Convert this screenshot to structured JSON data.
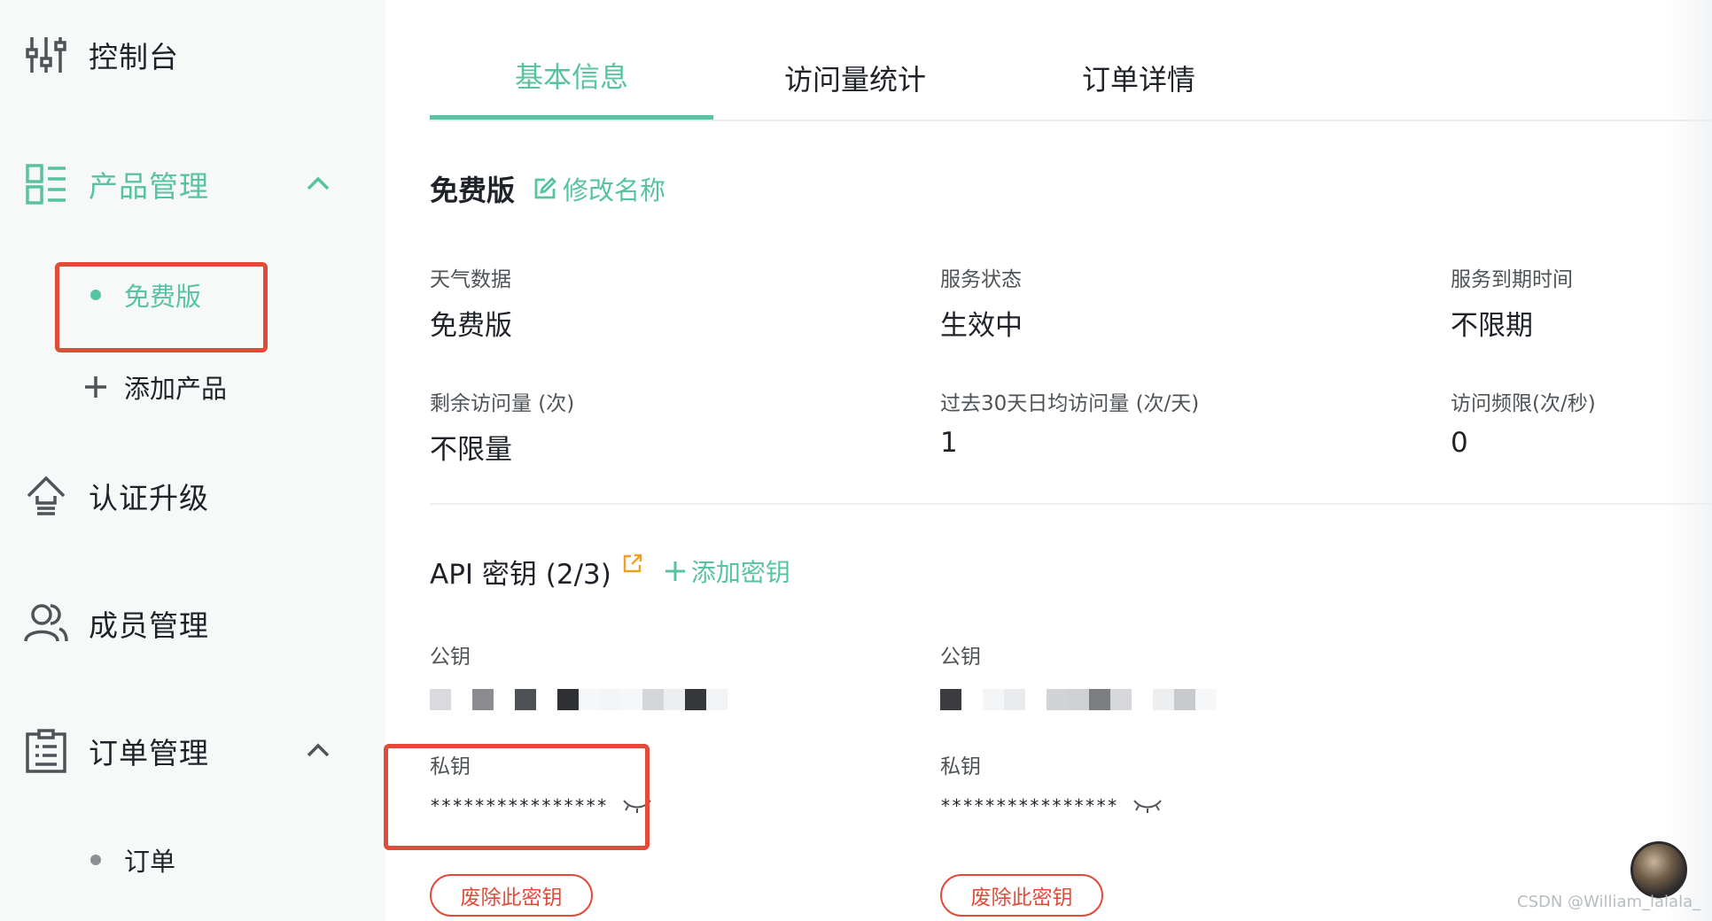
{
  "sidebar": {
    "items": [
      {
        "label": "控制台",
        "icon": "sliders-icon"
      },
      {
        "label": "产品管理",
        "icon": "grid-list-icon"
      },
      {
        "label": "认证升级",
        "icon": "upgrade-arrow-icon"
      },
      {
        "label": "成员管理",
        "icon": "users-icon"
      },
      {
        "label": "订单管理",
        "icon": "clipboard-list-icon"
      }
    ],
    "product_sub": {
      "free": "免费版",
      "add": "添加产品"
    },
    "order_sub": {
      "orders": "订单"
    }
  },
  "tabs": [
    "基本信息",
    "访问量统计",
    "订单详情"
  ],
  "plan": {
    "name": "免费版",
    "edit_label": "修改名称"
  },
  "info": [
    {
      "label": "天气数据",
      "value": "免费版"
    },
    {
      "label": "服务状态",
      "value": "生效中"
    },
    {
      "label": "服务到期时间",
      "value": "不限期"
    },
    {
      "label": "剩余访问量 (次)",
      "value": "不限量"
    },
    {
      "label": "过去30天日均访问量 (次/天)",
      "value": "1"
    },
    {
      "label": "访问频限(次/秒)",
      "value": "0"
    }
  ],
  "api": {
    "title": "API 密钥 (2/3)",
    "add_label": "添加密钥",
    "keys": [
      {
        "public_label": "公钥",
        "private_label": "私钥",
        "private_masked": "****************",
        "revoke_label": "废除此密钥"
      },
      {
        "public_label": "公钥",
        "private_label": "私钥",
        "private_masked": "****************",
        "revoke_label": "废除此密钥"
      }
    ]
  },
  "colors": {
    "accent": "#58c3a2",
    "danger": "#e24a3a",
    "highlight_box": "#e24a3a"
  },
  "watermark": "CSDN @William_lalala_"
}
